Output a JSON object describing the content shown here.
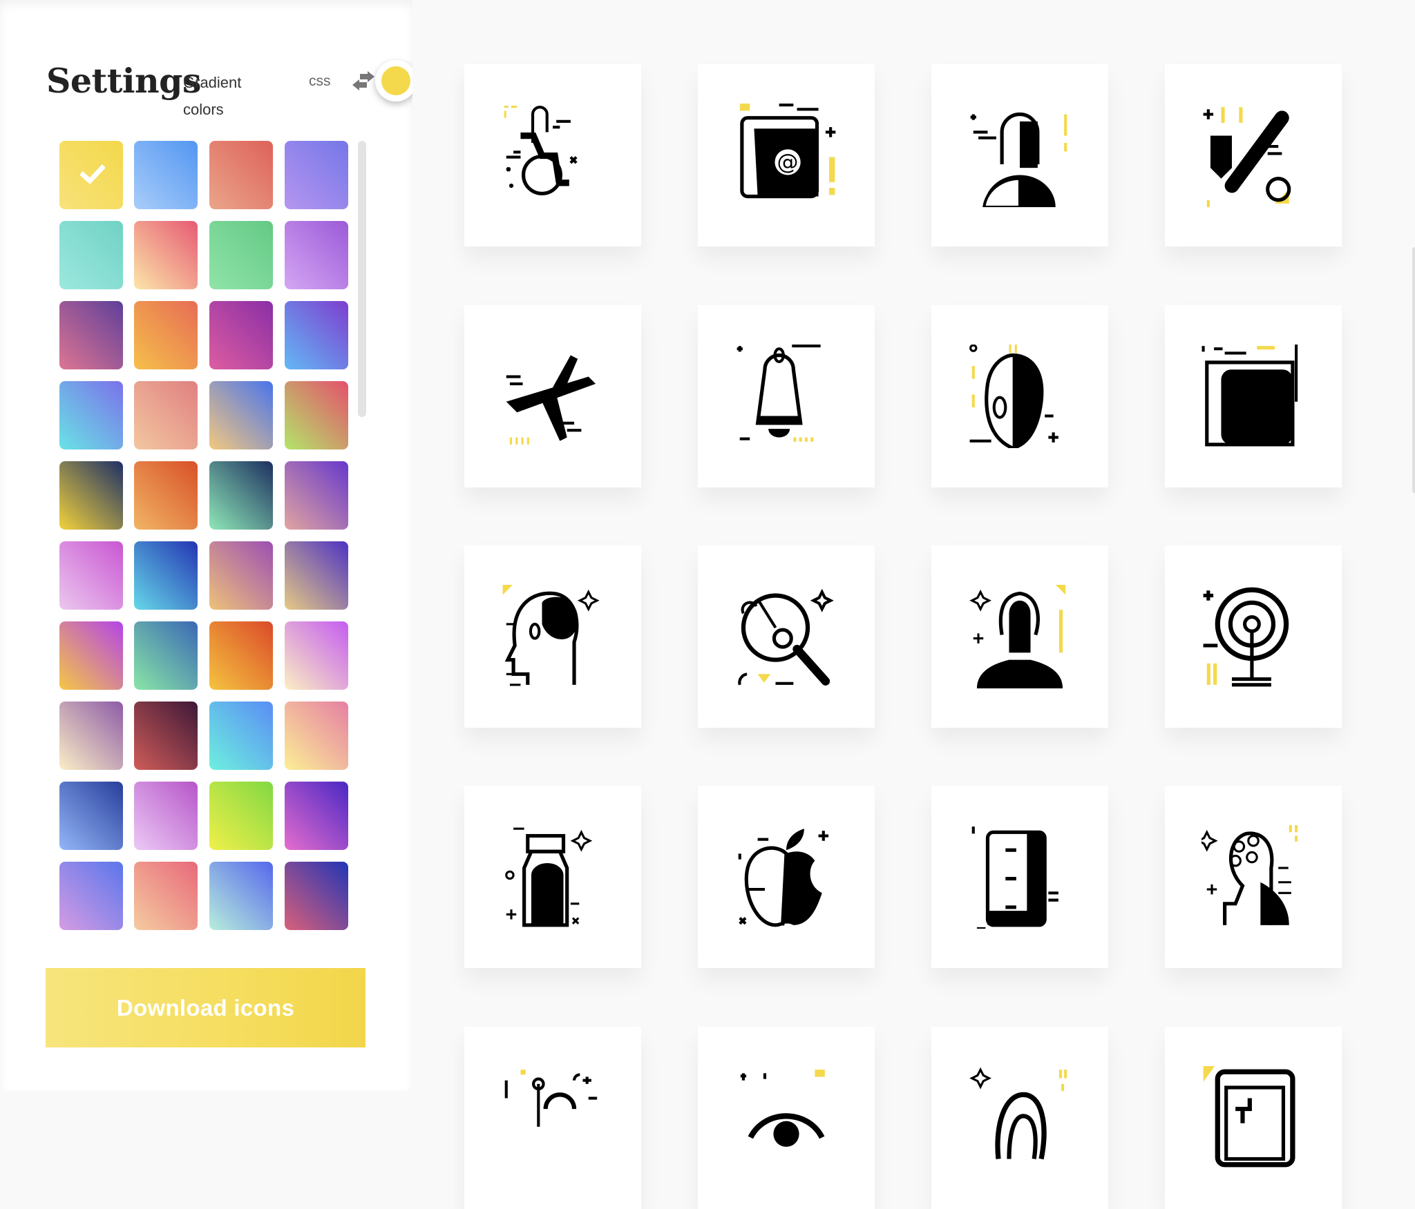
{
  "sidebar": {
    "title": "Settings",
    "mode_label": "Gradient colors",
    "css_label": "css",
    "swap_icon": "swap-arrows-icon",
    "selected_color": "#f4d94c",
    "swatches": [
      {
        "from": "#f8e27a",
        "to": "#f3d84a",
        "selected": true
      },
      {
        "from": "#a8cdfa",
        "to": "#5396f1",
        "selected": false
      },
      {
        "from": "#eaa58a",
        "to": "#de6259",
        "selected": false
      },
      {
        "from": "#b596ef",
        "to": "#7576e8",
        "selected": false
      },
      {
        "from": "#9ce8df",
        "to": "#70d2c4",
        "selected": false
      },
      {
        "from": "#fbe6a8",
        "to": "#e75a74",
        "selected": false
      },
      {
        "from": "#8fe4a8",
        "to": "#64c985",
        "selected": false
      },
      {
        "from": "#d4a6f3",
        "to": "#9c5ad8",
        "selected": false
      },
      {
        "from": "#de7592",
        "to": "#5e3f9a",
        "selected": false
      },
      {
        "from": "#f5c04a",
        "to": "#e76c55",
        "selected": false
      },
      {
        "from": "#dd5da1",
        "to": "#8a2ea6",
        "selected": false
      },
      {
        "from": "#63b9f5",
        "to": "#7e3dcf",
        "selected": false
      },
      {
        "from": "#69e3e5",
        "to": "#7b71ea",
        "selected": false
      },
      {
        "from": "#f3c7a0",
        "to": "#e08081",
        "selected": false
      },
      {
        "from": "#f3c87f",
        "to": "#4a74ec",
        "selected": false
      },
      {
        "from": "#b3e66a",
        "to": "#e4506c",
        "selected": false
      },
      {
        "from": "#f3d23b",
        "to": "#1d3066",
        "selected": false
      },
      {
        "from": "#f1b565",
        "to": "#d85028",
        "selected": false
      },
      {
        "from": "#8fe8b7",
        "to": "#1d3060",
        "selected": false
      },
      {
        "from": "#e1a5a0",
        "to": "#6638cc",
        "selected": false
      },
      {
        "from": "#ebc8ee",
        "to": "#c956d3",
        "selected": false
      },
      {
        "from": "#66d8e8",
        "to": "#2335b3",
        "selected": false
      },
      {
        "from": "#eec27a",
        "to": "#9c4fb3",
        "selected": false
      },
      {
        "from": "#e6ca84",
        "to": "#4d32c4",
        "selected": false
      },
      {
        "from": "#f5c745",
        "to": "#b444e8",
        "selected": false
      },
      {
        "from": "#89e6a6",
        "to": "#3a68b5",
        "selected": false
      },
      {
        "from": "#f5c440",
        "to": "#db4a28",
        "selected": false
      },
      {
        "from": "#fbefc2",
        "to": "#c45cf0",
        "selected": false
      },
      {
        "from": "#fbeec6",
        "to": "#8d5ca6",
        "selected": false
      },
      {
        "from": "#cf5c58",
        "to": "#3e1838",
        "selected": false
      },
      {
        "from": "#6ef0de",
        "to": "#5a8df5",
        "selected": false
      },
      {
        "from": "#fbef96",
        "to": "#e67fa3",
        "selected": false
      },
      {
        "from": "#93b6f7",
        "to": "#283e9c",
        "selected": false
      },
      {
        "from": "#ecc9f6",
        "to": "#b656c8",
        "selected": false
      },
      {
        "from": "#f0f04a",
        "to": "#82d843",
        "selected": false
      },
      {
        "from": "#e56dce",
        "to": "#4a28c4",
        "selected": false
      },
      {
        "from": "#d59ce3",
        "to": "#5a76ec",
        "selected": false
      },
      {
        "from": "#f5cca0",
        "to": "#e8697a",
        "selected": false
      },
      {
        "from": "#b8eedc",
        "to": "#5668ec",
        "selected": false
      },
      {
        "from": "#d9607a",
        "to": "#2235b6",
        "selected": false
      }
    ],
    "download_label": "Download icons"
  },
  "icons": [
    {
      "name": "wheelchair-icon",
      "accent": "#f4d94c"
    },
    {
      "name": "address-book-icon",
      "accent": "#f4d94c"
    },
    {
      "name": "man-portrait-icon",
      "accent": "#f4d94c"
    },
    {
      "name": "pen-tool-icon",
      "accent": "#f4d94c"
    },
    {
      "name": "airplane-icon",
      "accent": "#f4d94c"
    },
    {
      "name": "bell-icon",
      "accent": "#f4d94c"
    },
    {
      "name": "alien-icon",
      "accent": "#f4d94c"
    },
    {
      "name": "folder-icon",
      "accent": "#f4d94c"
    },
    {
      "name": "brain-head-icon",
      "accent": "#f4d94c"
    },
    {
      "name": "data-search-icon",
      "accent": "#f4d94c"
    },
    {
      "name": "hearing-person-icon",
      "accent": "#f4d94c"
    },
    {
      "name": "signal-antenna-icon",
      "accent": "#f4d94c"
    },
    {
      "name": "jar-icon",
      "accent": "#f4d94c"
    },
    {
      "name": "apple-icon",
      "accent": "#f4d94c"
    },
    {
      "name": "filing-cabinet-icon",
      "accent": "#f4d94c"
    },
    {
      "name": "ai-head-icon",
      "accent": "#f4d94c"
    },
    {
      "name": "network-icon",
      "accent": "#f4d94c"
    },
    {
      "name": "eye-icon",
      "accent": "#f4d94c"
    },
    {
      "name": "ear-icon",
      "accent": "#f4d94c"
    },
    {
      "name": "browser-window-icon",
      "accent": "#f4d94c"
    }
  ]
}
